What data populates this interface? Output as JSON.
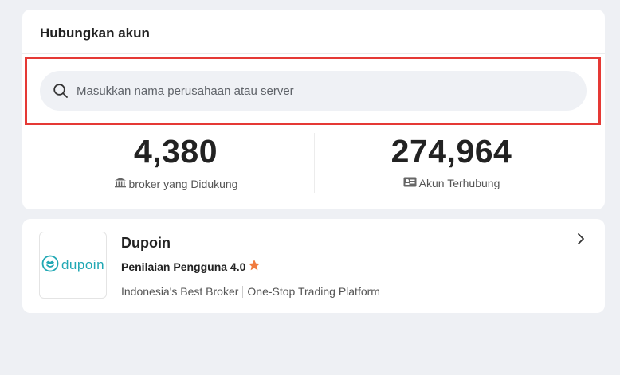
{
  "header": {
    "title": "Hubungkan akun"
  },
  "search": {
    "placeholder": "Masukkan nama perusahaan atau server",
    "value": ""
  },
  "stats": [
    {
      "value": "4,380",
      "label": "broker yang Didukung",
      "icon": "bank-icon"
    },
    {
      "value": "274,964",
      "label": "Akun Terhubung",
      "icon": "id-card-icon"
    }
  ],
  "broker": {
    "name": "Dupoin",
    "logo_text": "dupoin",
    "rating_label": "Penilaian Pengguna 4.0",
    "tags": [
      "Indonesia's Best Broker",
      "One-Stop Trading Platform"
    ]
  },
  "colors": {
    "background": "#eef0f4",
    "highlight_border": "#e53935",
    "brand": "#21a8b4",
    "star": "#f07b3f"
  }
}
